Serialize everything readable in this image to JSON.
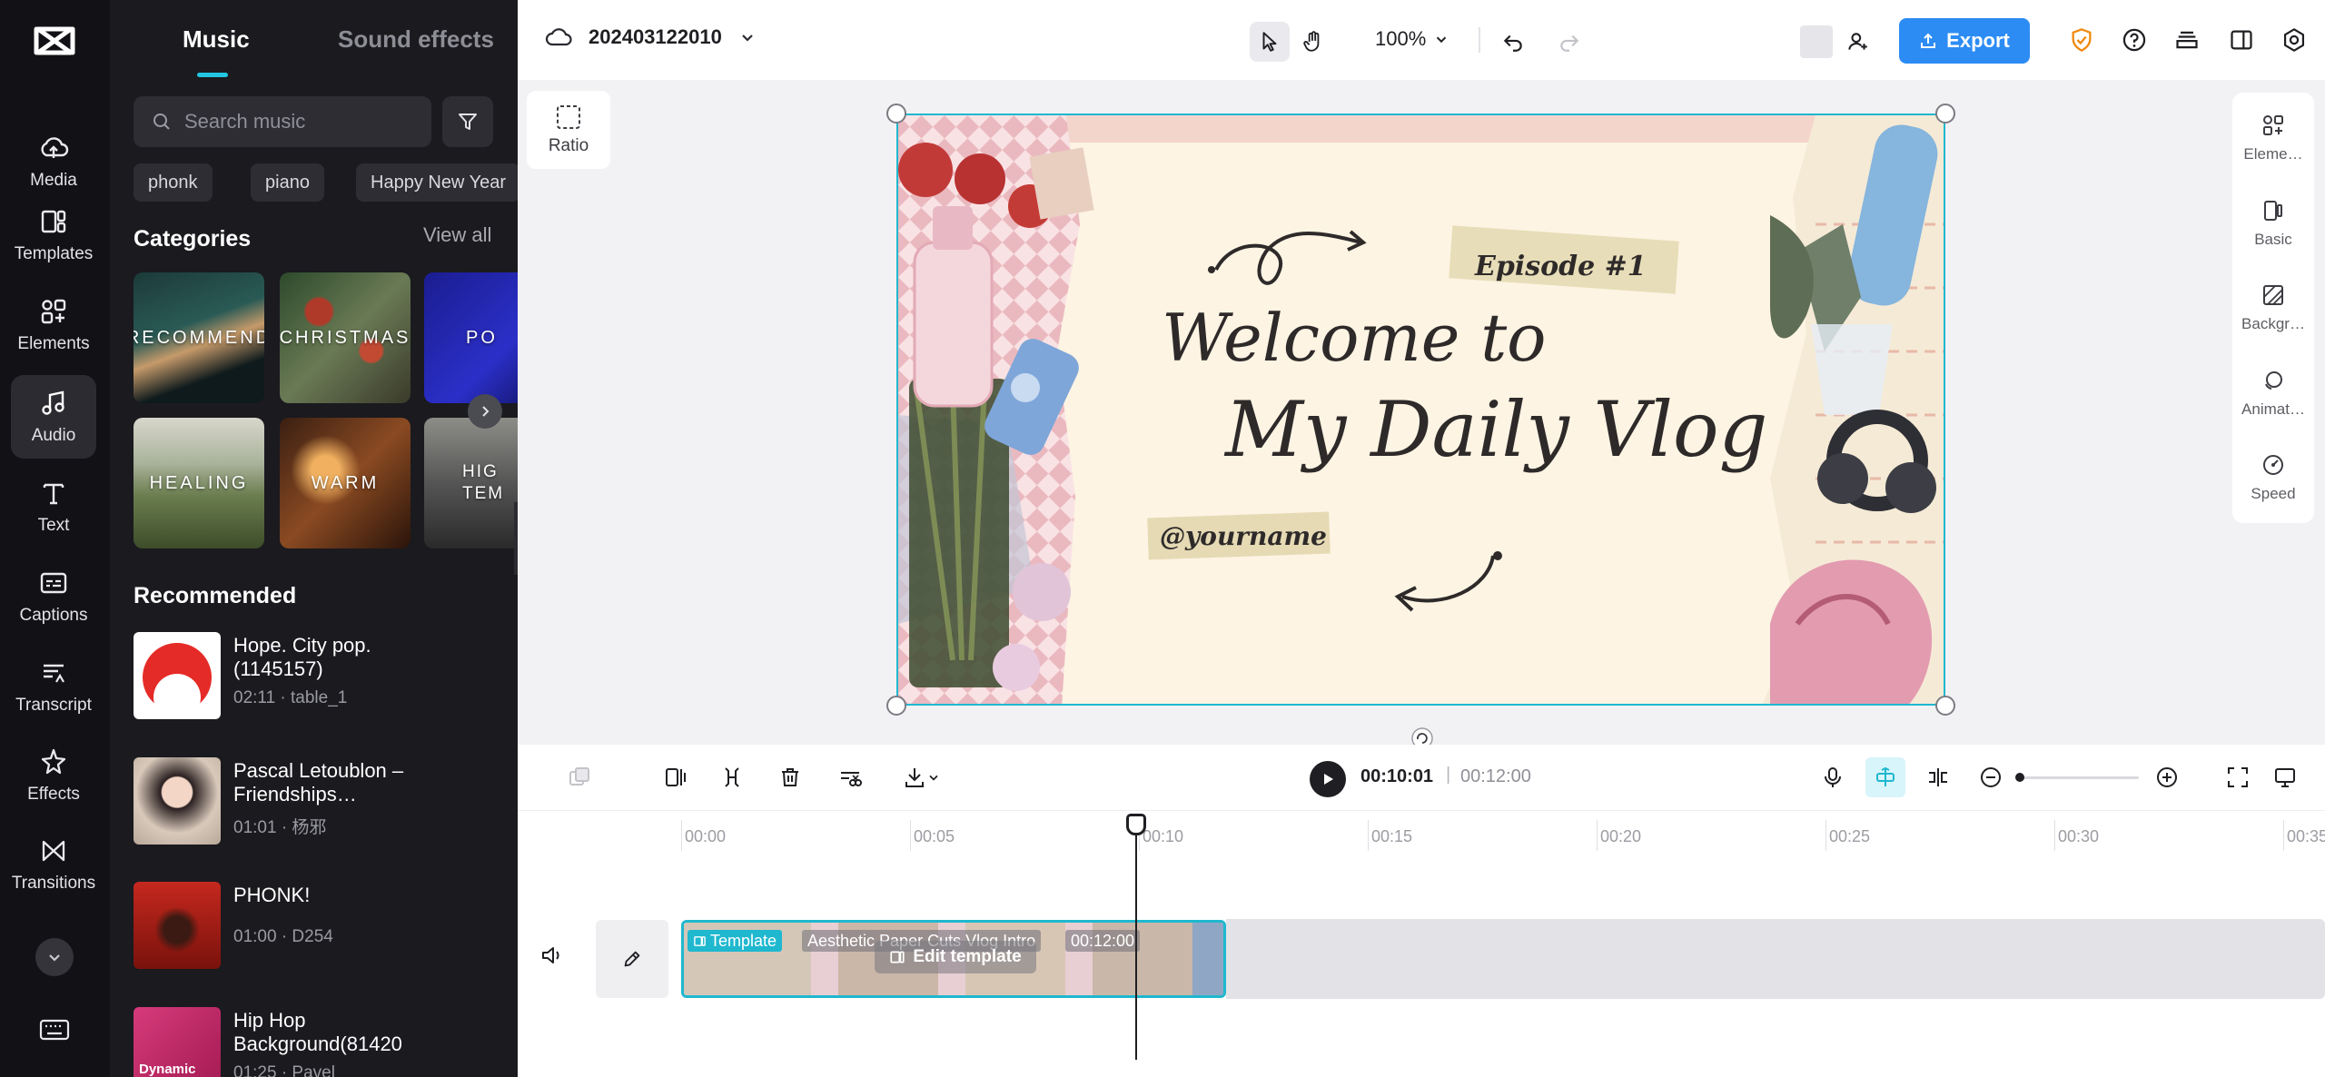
{
  "rail": {
    "items": [
      {
        "label": "Media",
        "icon": "cloud-upload-icon"
      },
      {
        "label": "Templates",
        "icon": "templates-icon"
      },
      {
        "label": "Elements",
        "icon": "elements-icon"
      },
      {
        "label": "Audio",
        "icon": "music-note-icon"
      },
      {
        "label": "Text",
        "icon": "text-icon"
      },
      {
        "label": "Captions",
        "icon": "captions-icon"
      },
      {
        "label": "Transcript",
        "icon": "transcript-icon"
      },
      {
        "label": "Effects",
        "icon": "effects-icon"
      },
      {
        "label": "Transitions",
        "icon": "transitions-icon"
      }
    ],
    "active": "Audio"
  },
  "panel": {
    "tabs": [
      "Music",
      "Sound effects"
    ],
    "search_placeholder": "Search music",
    "chips": [
      "phonk",
      "piano",
      "Happy New Year"
    ],
    "categories_title": "Categories",
    "view_all": "View all",
    "categories": [
      "RECOMMEND",
      "CHRISTMAS",
      "PO",
      "HEALING",
      "WARM",
      "HIG TEM"
    ],
    "recommended_title": "Recommended",
    "tracks": [
      {
        "title": "Hope. City pop. (1145157)",
        "meta": "02:11 · table_1"
      },
      {
        "title": "Pascal Letoublon – Friendships…",
        "meta": "01:01 · 杨邪"
      },
      {
        "title": "PHONK!",
        "meta": "01:00 · D254"
      },
      {
        "title": "Hip Hop Background(81420",
        "meta": "01:25 · Pavel",
        "thumb_label": "Dynamic"
      }
    ]
  },
  "topbar": {
    "project_name": "202403122010",
    "zoom": "100%",
    "export_label": "Export"
  },
  "workspace": {
    "ratio_label": "Ratio",
    "props": [
      "Eleme…",
      "Basic",
      "Backgr…",
      "Animat…",
      "Speed"
    ]
  },
  "canvas": {
    "episode": "Episode #1",
    "title_line1": "Welcome to",
    "title_line2": "My Daily Vlog",
    "handle": "@yourname"
  },
  "timeline": {
    "current_time": "00:10:01",
    "separator": "|",
    "total_time": "00:12:00",
    "ruler_labels": [
      "00:00",
      "00:05",
      "00:10",
      "00:15",
      "00:20",
      "00:25",
      "00:30",
      "00:35"
    ],
    "clip": {
      "tag": "Template",
      "name": "Aesthetic Paper Cuts Vlog Intro",
      "duration": "00:12:00",
      "edit_label": "Edit template"
    }
  },
  "colors": {
    "accent": "#1fb8cf",
    "export": "#2c8cf4",
    "rail_bg": "#121216",
    "panel_bg": "#1a1a1f"
  }
}
